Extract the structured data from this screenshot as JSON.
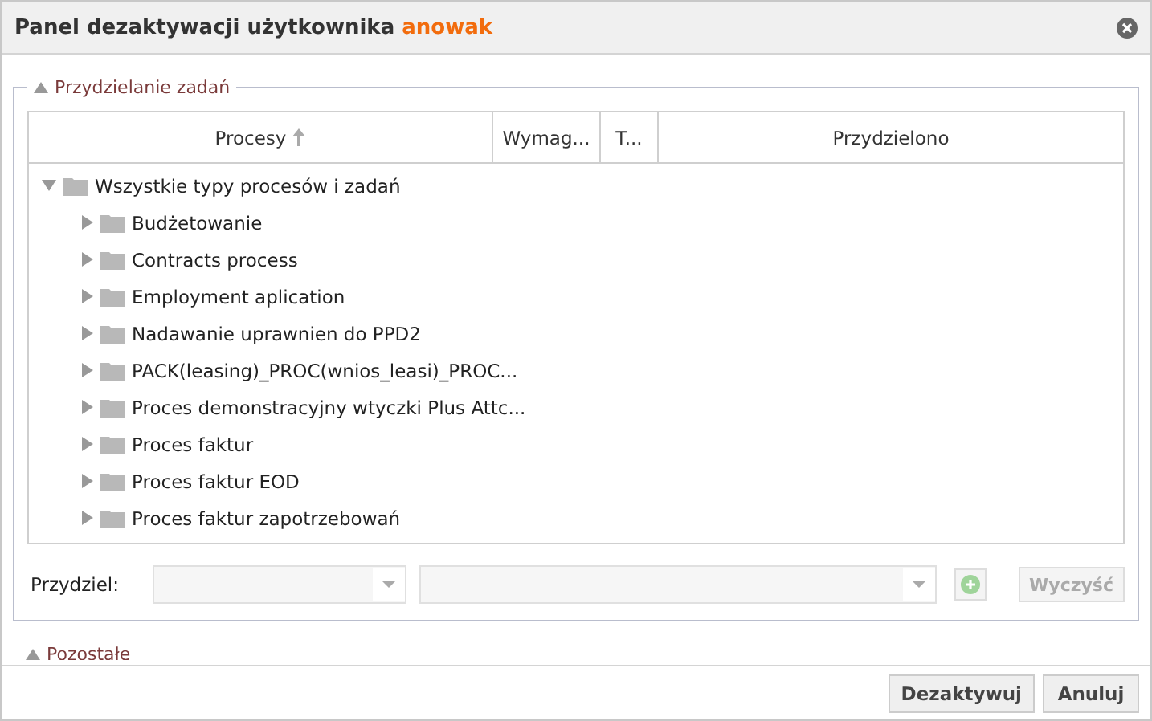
{
  "window": {
    "title": "Panel dezaktywacji użytkownika",
    "user": "anowak"
  },
  "assign_section": {
    "legend": "Przydzielanie zadań",
    "expanded": true
  },
  "table": {
    "columns": [
      {
        "label": "Procesy",
        "sorted": true
      },
      {
        "label": "Wymag..."
      },
      {
        "label": "T..."
      },
      {
        "label": "Przydzielono"
      }
    ],
    "tree": [
      {
        "label": "Wszystkie typy procesów i zadań",
        "expanded": true,
        "children": [
          {
            "label": "Budżetowanie",
            "expanded": false
          },
          {
            "label": "Contracts process",
            "expanded": false
          },
          {
            "label": "Employment aplication",
            "expanded": false
          },
          {
            "label": "Nadawanie uprawnien do PPD2",
            "expanded": false
          },
          {
            "label": "PACK(leasing)_PROC(wnios_leasi)_PROC...",
            "expanded": false
          },
          {
            "label": "Proces demonstracyjny wtyczki Plus Attc...",
            "expanded": false
          },
          {
            "label": "Proces faktur",
            "expanded": false
          },
          {
            "label": "Proces faktur EOD",
            "expanded": false
          },
          {
            "label": "Proces faktur zapotrzebowań",
            "expanded": false
          }
        ]
      }
    ]
  },
  "assign": {
    "label": "Przydziel:",
    "clear_button": "Wyczyść"
  },
  "other_section": {
    "legend": "Pozostałe",
    "expanded": true
  },
  "buttons": [
    "Dezaktywuj",
    "Anuluj"
  ]
}
